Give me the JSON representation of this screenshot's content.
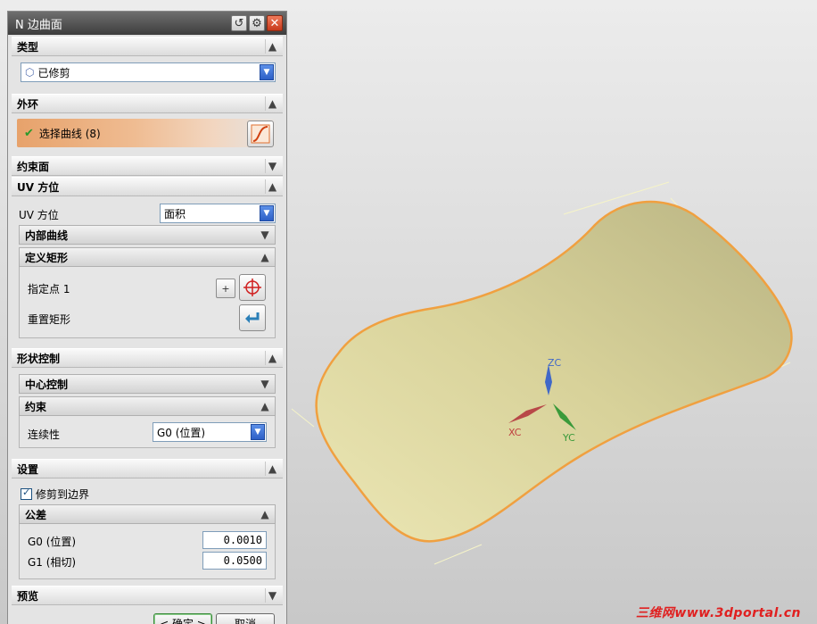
{
  "dialog": {
    "title": "N 边曲面",
    "sections": {
      "type": {
        "header": "类型",
        "combo_value": "已修剪"
      },
      "outer_loop": {
        "header": "外环",
        "select_label": "选择曲线 (8)"
      },
      "constraint_face": {
        "header": "约束面"
      },
      "uv_orientation": {
        "header": "UV 方位",
        "field_label": "UV 方位",
        "combo_value": "面积",
        "inner_curves": "内部曲线",
        "define_rect": {
          "header": "定义矩形",
          "point_label": "指定点 1",
          "reset_label": "重置矩形"
        }
      },
      "shape_control": {
        "header": "形状控制",
        "center_control": "中心控制",
        "constraint": {
          "header": "约束",
          "continuity_label": "连续性",
          "continuity_value": "G0 (位置)"
        }
      },
      "settings": {
        "header": "设置",
        "trim_label": "修剪到边界",
        "tolerance": {
          "header": "公差",
          "g0_label": "G0 (位置)",
          "g0_value": "0.0010",
          "g1_label": "G1 (相切)",
          "g1_value": "0.0500"
        }
      },
      "preview": {
        "header": "预览"
      }
    },
    "buttons": {
      "ok": "< 确定 >",
      "cancel": "取消"
    }
  },
  "viewport": {
    "axes": {
      "z": "ZC",
      "x": "XC",
      "y": "YC"
    },
    "surface_color": "#d9d29a",
    "edge_color": "#f0a040"
  },
  "watermark": "三维网www.3dportal.cn",
  "icons": [
    "reset-icon",
    "gear-icon",
    "close-icon",
    "surface-type-icon",
    "check-icon",
    "curve-icon",
    "point-dialog-icon",
    "crosshair-icon",
    "reset-rect-icon",
    "chevron-up-icon",
    "chevron-down-icon"
  ]
}
